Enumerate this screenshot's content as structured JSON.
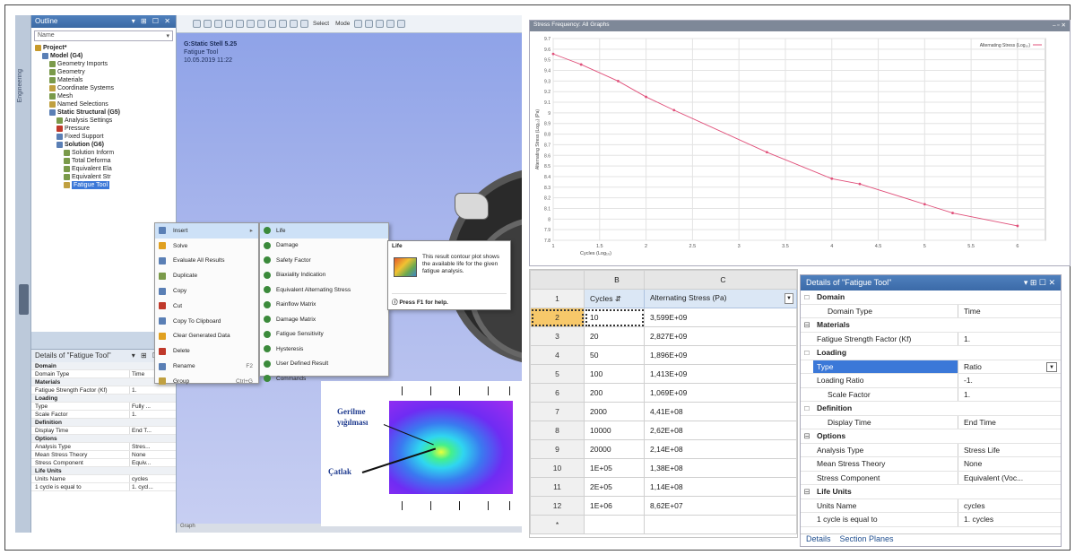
{
  "outline": {
    "title": "Outline",
    "controls": "▾ ⊞ ☐ ✕",
    "filter_label": "Name",
    "tree": [
      {
        "label": "Project*",
        "bold": true,
        "indent": 0,
        "color": "#c79a2b"
      },
      {
        "label": "Model (G4)",
        "bold": true,
        "indent": 1,
        "color": "#5a7fb5"
      },
      {
        "label": "Geometry Imports",
        "bold": false,
        "indent": 2,
        "color": "#7a9a4a"
      },
      {
        "label": "Geometry",
        "bold": false,
        "indent": 2,
        "color": "#7a9a4a"
      },
      {
        "label": "Materials",
        "bold": false,
        "indent": 2,
        "color": "#7a9a4a"
      },
      {
        "label": "Coordinate Systems",
        "bold": false,
        "indent": 2,
        "color": "#c0a040"
      },
      {
        "label": "Mesh",
        "bold": false,
        "indent": 2,
        "color": "#7a9a4a"
      },
      {
        "label": "Named Selections",
        "bold": false,
        "indent": 2,
        "color": "#c0a040"
      },
      {
        "label": "Static Structural (G5)",
        "bold": true,
        "indent": 2,
        "color": "#5a7fb5"
      },
      {
        "label": "Analysis Settings",
        "bold": false,
        "indent": 3,
        "color": "#7a9a4a"
      },
      {
        "label": "Pressure",
        "bold": false,
        "indent": 3,
        "color": "#c0392b"
      },
      {
        "label": "Fixed Support",
        "bold": false,
        "indent": 3,
        "color": "#5a7fb5"
      },
      {
        "label": "Solution (G6)",
        "bold": true,
        "indent": 3,
        "color": "#5a7fb5"
      },
      {
        "label": "Solution Inform",
        "bold": false,
        "indent": 4,
        "color": "#7a9a4a"
      },
      {
        "label": "Total Deforma",
        "bold": false,
        "indent": 4,
        "color": "#7a9a4a"
      },
      {
        "label": "Equivalent Ela",
        "bold": false,
        "indent": 4,
        "color": "#7a9a4a"
      },
      {
        "label": "Equivalent Str",
        "bold": false,
        "indent": 4,
        "color": "#7a9a4a"
      },
      {
        "label": "Fatigue Tool",
        "bold": false,
        "indent": 4,
        "color": "#c0a040",
        "selected": true
      }
    ]
  },
  "details_small": {
    "title": "Details of \"Fatigue Tool\"",
    "controls": "▾ ⊞ ☐ ✕",
    "rows": [
      {
        "k": "Domain",
        "v": "",
        "sec": true
      },
      {
        "k": "Domain Type",
        "v": "Time"
      },
      {
        "k": "Materials",
        "v": "",
        "sec": true
      },
      {
        "k": "Fatigue Strength Factor (Kf)",
        "v": "1."
      },
      {
        "k": "Loading",
        "v": "",
        "sec": true
      },
      {
        "k": "Type",
        "v": "Fully ..."
      },
      {
        "k": "Scale Factor",
        "v": "1."
      },
      {
        "k": "Definition",
        "v": "",
        "sec": true
      },
      {
        "k": "Display Time",
        "v": "End T..."
      },
      {
        "k": "Options",
        "v": "",
        "sec": true
      },
      {
        "k": "Analysis Type",
        "v": "Stres..."
      },
      {
        "k": "Mean Stress Theory",
        "v": "None"
      },
      {
        "k": "Stress Component",
        "v": "Equiv..."
      },
      {
        "k": "Life Units",
        "v": "",
        "sec": true
      },
      {
        "k": "Units Name",
        "v": "cycles"
      },
      {
        "k": "1 cycle is equal to",
        "v": "1. cycl..."
      }
    ]
  },
  "toolbar": {
    "select_label": "Select",
    "mode_label": "Mode"
  },
  "viewport": {
    "title": "G:Static Stell 5.25",
    "subtitle": "Fatigue Tool",
    "date": "10.05.2019 11:22",
    "status": "Graph"
  },
  "context_menu": {
    "items": [
      {
        "label": "Insert",
        "shortcut": "▸",
        "color": "#5a7fb5",
        "hl": true
      },
      {
        "label": "Solve",
        "shortcut": "",
        "color": "#e0a020"
      },
      {
        "label": "Evaluate All Results",
        "shortcut": "",
        "color": "#5a7fb5"
      },
      {
        "label": "Duplicate",
        "shortcut": "",
        "color": "#7a9a4a"
      },
      {
        "label": "Copy",
        "shortcut": "",
        "color": "#5a7fb5"
      },
      {
        "label": "Cut",
        "shortcut": "",
        "color": "#c0392b"
      },
      {
        "label": "Copy To Clipboard",
        "shortcut": "",
        "color": "#5a7fb5"
      },
      {
        "label": "Clear Generated Data",
        "shortcut": "",
        "color": "#e0a020"
      },
      {
        "label": "Delete",
        "shortcut": "",
        "color": "#c0392b"
      },
      {
        "label": "Rename",
        "shortcut": "F2",
        "color": "#5a7fb5"
      },
      {
        "label": "Group",
        "shortcut": "Ctrl+G",
        "color": "#c0a040"
      }
    ]
  },
  "submenu": {
    "items": [
      "Life",
      "Damage",
      "Safety Factor",
      "Biaxiality Indication",
      "Equivalent Alternating Stress",
      "Rainflow Matrix",
      "Damage Matrix",
      "Fatigue Sensitivity",
      "Hysteresis",
      "User Defined Result",
      "Commands"
    ]
  },
  "tooltip": {
    "title": "Life",
    "description": "This result contour plot shows the available life for the given fatigue analysis.",
    "help": "Press F1 for help."
  },
  "crack_figure": {
    "label_stress": "Gerilme yığılması",
    "label_crack": "Çatlak"
  },
  "chart_window": {
    "title": "Stress Frequency: All Graphs",
    "controls": "– ▫ ✕"
  },
  "chart_data": {
    "type": "line",
    "title": "",
    "xlabel": "Cycles (Log₁₀)",
    "ylabel": "Alternating Stress (Log₁₀) (Pa)",
    "legend": "Alternating Stress (Log₁₀)",
    "legend_position": "top-right",
    "grid": true,
    "xlim": [
      1,
      6.3
    ],
    "ylim": [
      7.8,
      9.7
    ],
    "x": [
      1,
      1.30103,
      1.69897,
      2,
      2.30103,
      3.30103,
      4,
      4.30103,
      5,
      5.30103,
      6
    ],
    "y": [
      9.5553,
      9.4556,
      9.2995,
      9.1505,
      9.0253,
      8.6294,
      8.3802,
      8.3304,
      8.1399,
      8.0569,
      7.9355
    ],
    "xticks": [
      "1",
      "1.5",
      "2",
      "2.5",
      "3",
      "3.5",
      "4",
      "4.5",
      "5",
      "5.5",
      "6"
    ],
    "yticks": [
      "7.8",
      "7.9",
      "8",
      "8.1",
      "8.2",
      "8.3",
      "8.4",
      "8.5",
      "8.6",
      "8.7",
      "8.8",
      "8.9",
      "9",
      "9.1",
      "9.2",
      "9.3",
      "9.4",
      "9.5",
      "9.6",
      "9.7"
    ],
    "line_color": "#e0507a"
  },
  "table": {
    "col_b": "B",
    "col_c": "C",
    "head_cycles": "Cycles",
    "head_stress": "Alternating Stress (Pa)",
    "rows": [
      {
        "n": "2",
        "cycles": "10",
        "stress": "3,599E+09"
      },
      {
        "n": "3",
        "cycles": "20",
        "stress": "2,827E+09"
      },
      {
        "n": "4",
        "cycles": "50",
        "stress": "1,896E+09"
      },
      {
        "n": "5",
        "cycles": "100",
        "stress": "1,413E+09"
      },
      {
        "n": "6",
        "cycles": "200",
        "stress": "1,069E+09"
      },
      {
        "n": "7",
        "cycles": "2000",
        "stress": "4,41E+08"
      },
      {
        "n": "8",
        "cycles": "10000",
        "stress": "2,62E+08"
      },
      {
        "n": "9",
        "cycles": "20000",
        "stress": "2,14E+08"
      },
      {
        "n": "10",
        "cycles": "1E+05",
        "stress": "1,38E+08"
      },
      {
        "n": "11",
        "cycles": "2E+05",
        "stress": "1,14E+08"
      },
      {
        "n": "12",
        "cycles": "1E+06",
        "stress": "8,62E+07"
      }
    ],
    "header_row_num": "1",
    "new_row_marker": "*"
  },
  "details": {
    "title": "Details of \"Fatigue Tool\"",
    "controls": "▾ ⊞ ☐ ✕",
    "rows": [
      {
        "k": "Domain",
        "v": "",
        "sec": true,
        "exp": "□"
      },
      {
        "k": "Domain Type",
        "v": "Time",
        "ind": true
      },
      {
        "k": "Materials",
        "v": "",
        "sec": true,
        "exp": "⊟"
      },
      {
        "k": "Fatigue Strength Factor (Kf)",
        "v": "1."
      },
      {
        "k": "Loading",
        "v": "",
        "sec": true,
        "exp": "□"
      },
      {
        "k": "Type",
        "v": "Ratio",
        "hl": true,
        "select": true
      },
      {
        "k": "Loading Ratio",
        "v": "-1."
      },
      {
        "k": "Scale Factor",
        "v": "1.",
        "ind": true
      },
      {
        "k": "Definition",
        "v": "",
        "sec": true,
        "exp": "□"
      },
      {
        "k": "Display Time",
        "v": "End Time",
        "ind": true
      },
      {
        "k": "Options",
        "v": "",
        "sec": true,
        "exp": "⊟"
      },
      {
        "k": "Analysis Type",
        "v": "Stress Life"
      },
      {
        "k": "Mean Stress Theory",
        "v": "None"
      },
      {
        "k": "Stress Component",
        "v": "Equivalent (Voc..."
      },
      {
        "k": "Life Units",
        "v": "",
        "sec": true,
        "exp": "⊟"
      },
      {
        "k": "Units Name",
        "v": "cycles"
      },
      {
        "k": "1 cycle is equal to",
        "v": "1. cycles"
      }
    ],
    "tab_details": "Details",
    "tab_section": "Section Planes"
  }
}
